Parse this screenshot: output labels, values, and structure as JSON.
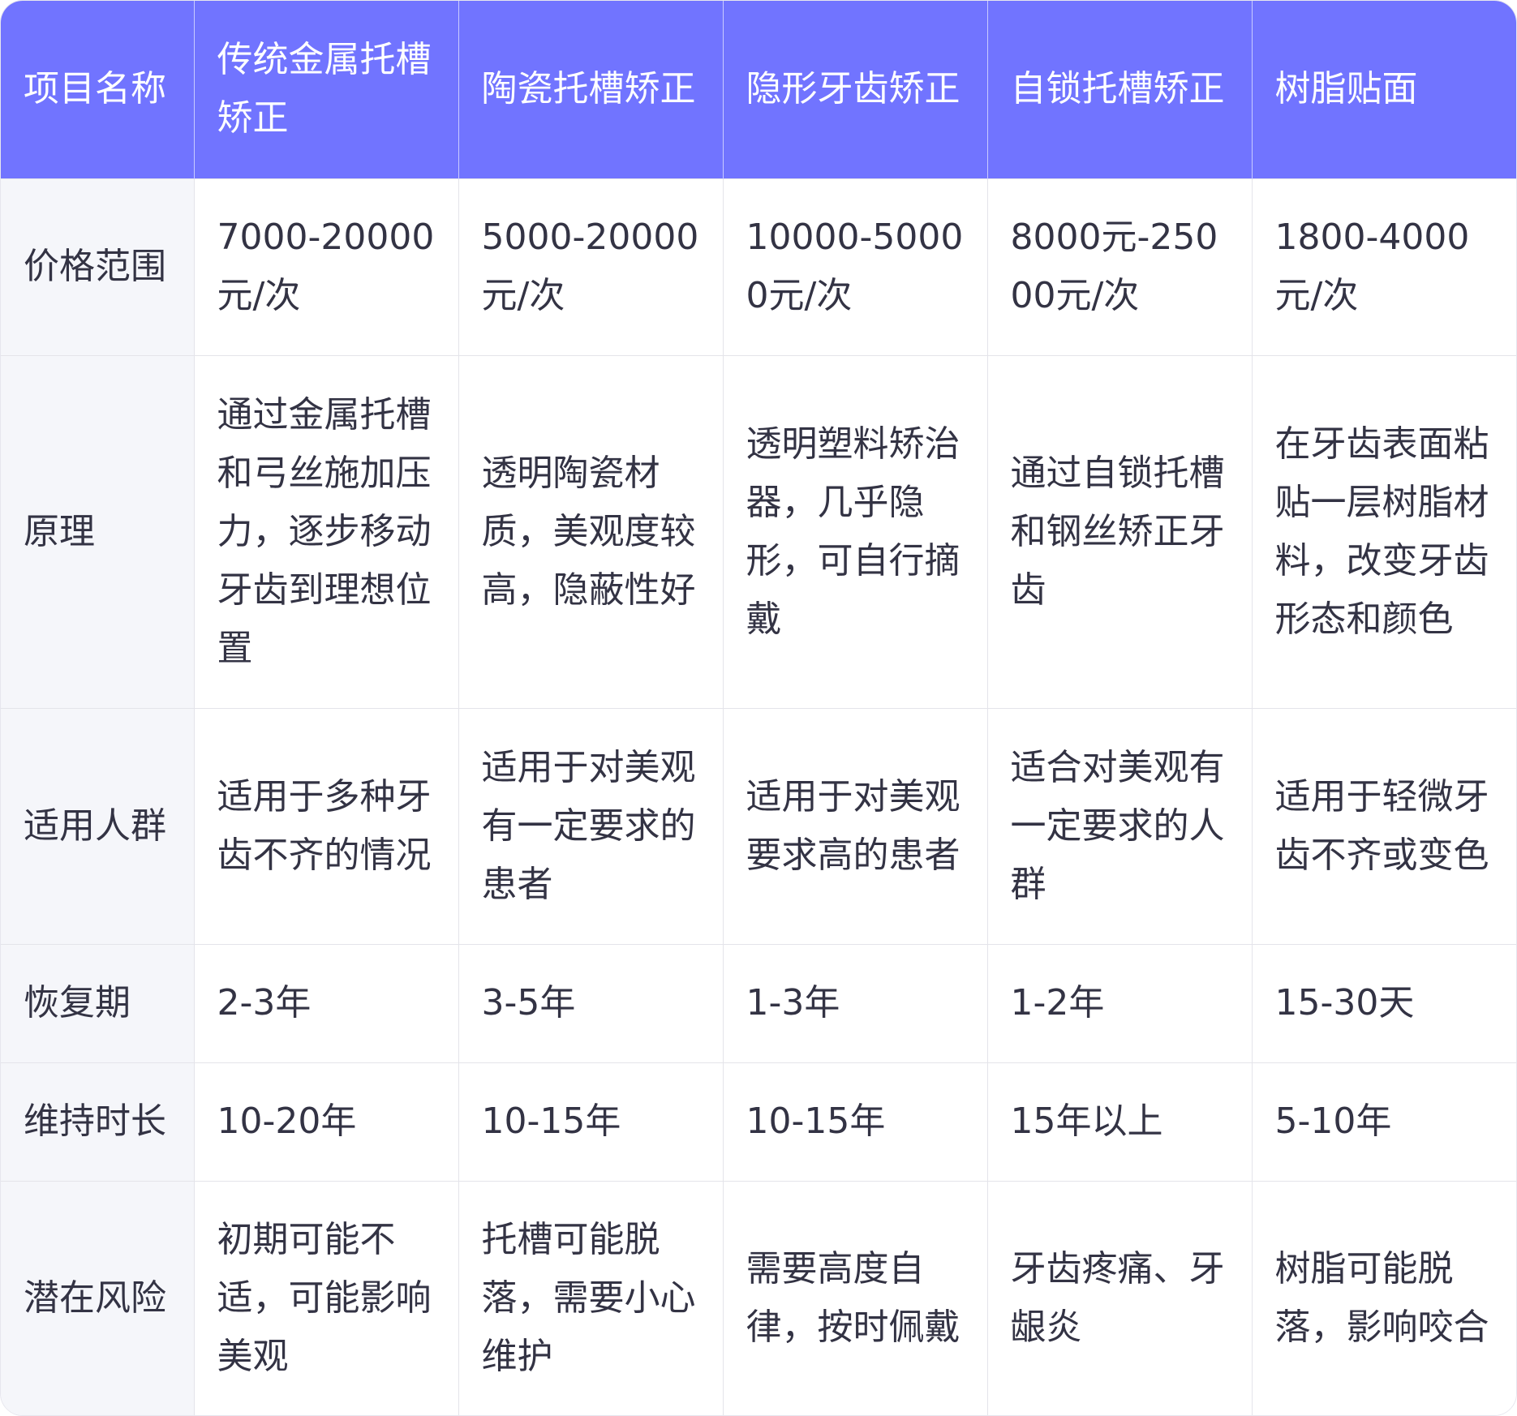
{
  "table": {
    "header": [
      "项目名称",
      "传统金属托槽矫正",
      "陶瓷托槽矫正",
      "隐形牙齿矫正",
      "自锁托槽矫正",
      "树脂贴面"
    ],
    "rows": [
      {
        "key": "price",
        "label": "价格范围",
        "cells": [
          "7000-20000元/次",
          "5000-20000元/次",
          "10000-50000元/次",
          "8000元-25000元/次",
          "1800-4000元/次"
        ]
      },
      {
        "key": "principle",
        "label": "原理",
        "cells": [
          "通过金属托槽和弓丝施加压力，逐步移动牙齿到理想位置",
          "透明陶瓷材质，美观度较高，隐蔽性好",
          "透明塑料矫治器，几乎隐形，可自行摘戴",
          "通过自锁托槽和钢丝矫正牙齿",
          "在牙齿表面粘贴一层树脂材料，改变牙齿形态和颜色"
        ]
      },
      {
        "key": "people",
        "label": "适用人群",
        "cells": [
          "适用于多种牙齿不齐的情况",
          "适用于对美观有一定要求的患者",
          "适用于对美观要求高的患者",
          "适合对美观有一定要求的人群",
          "适用于轻微牙齿不齐或变色"
        ]
      },
      {
        "key": "recovery",
        "label": "恢复期",
        "cells": [
          "2-3年",
          "3-5年",
          "1-3年",
          "1-2年",
          "15-30天"
        ]
      },
      {
        "key": "duration",
        "label": "维持时长",
        "cells": [
          "10-20年",
          "10-15年",
          "10-15年",
          "15年以上",
          "5-10年"
        ]
      },
      {
        "key": "risk",
        "label": "潜在风险",
        "cells": [
          "初期可能不适，可能影响美观",
          "托槽可能脱落，需要小心维护",
          "需要高度自律，按时佩戴",
          "牙齿疼痛、牙龈炎",
          "树脂可能脱落，影响咬合"
        ]
      }
    ]
  },
  "colors": {
    "header_bg": "#7174ff",
    "header_text": "#ffffff",
    "label_bg": "#f5f6fa",
    "body_text": "#333344",
    "grid": "#e4e4ea"
  }
}
